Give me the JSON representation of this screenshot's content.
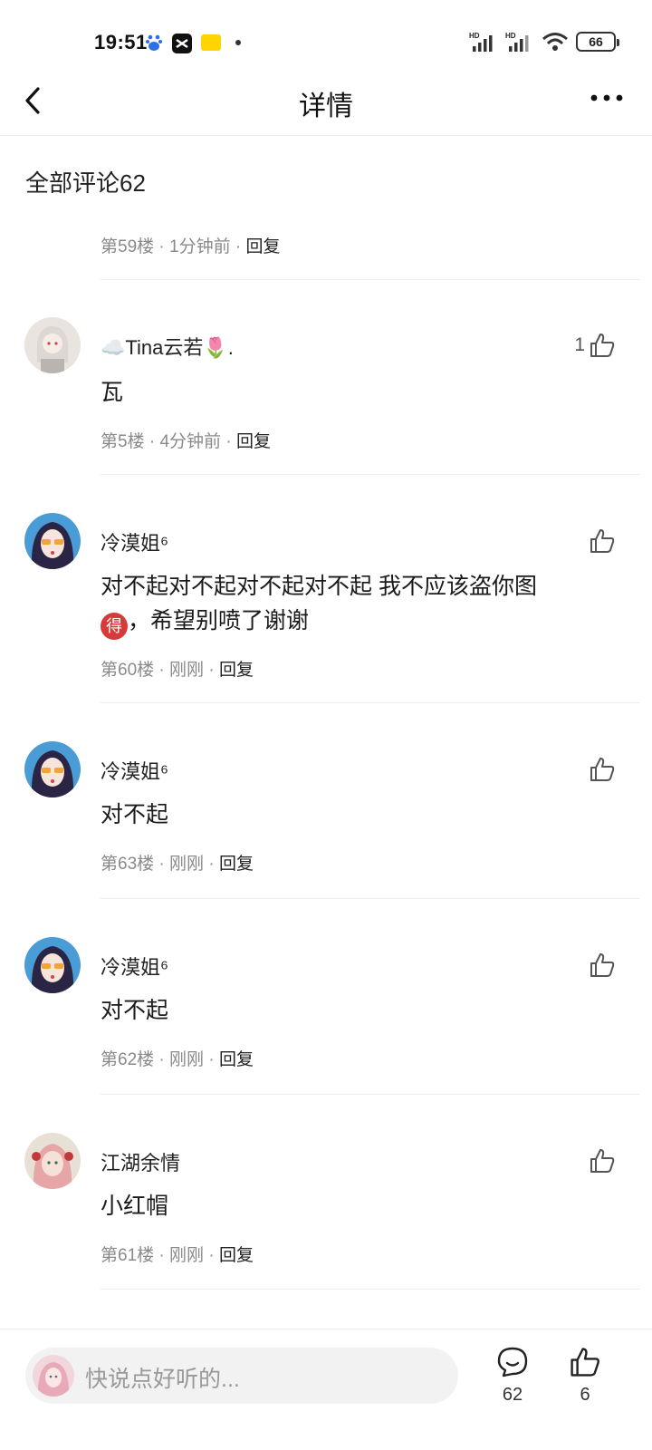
{
  "status_bar": {
    "time": "19:51",
    "signal_1": "HD",
    "signal_2": "HD",
    "battery": "66"
  },
  "nav": {
    "title": "详情"
  },
  "section": {
    "title": "全部评论62"
  },
  "top_meta": {
    "floor": "第59楼",
    "time": "1分钟前",
    "reply": "回复"
  },
  "comments": [
    {
      "username": "Tina云若",
      "prefix_emoji": "☁️",
      "suffix_emoji": "🌷.",
      "text": "瓦",
      "floor": "第5楼",
      "time": "4分钟前",
      "reply": "回复",
      "likes": "1"
    },
    {
      "username": "冷漠姐⁶",
      "text_main": "对不起对不起对不起对不起 我不应该盗你图",
      "badge": "得",
      "text_tail": "，希望别喷了谢谢",
      "floor": "第60楼",
      "time": "刚刚",
      "reply": "回复",
      "likes": ""
    },
    {
      "username": "冷漠姐⁶",
      "text": "对不起",
      "floor": "第63楼",
      "time": "刚刚",
      "reply": "回复",
      "likes": ""
    },
    {
      "username": "冷漠姐⁶",
      "text": "对不起",
      "floor": "第62楼",
      "time": "刚刚",
      "reply": "回复",
      "likes": ""
    },
    {
      "username": "江湖余情",
      "text": "小红帽",
      "floor": "第61楼",
      "time": "刚刚",
      "reply": "回复",
      "likes": ""
    }
  ],
  "bottom_bar": {
    "placeholder": "快说点好听的...",
    "comment_count": "62",
    "like_count": "6"
  },
  "colors": {
    "meta_gray": "#8a8a8a",
    "text": "#1a1a1a",
    "badge_red": "#d83a3a"
  }
}
